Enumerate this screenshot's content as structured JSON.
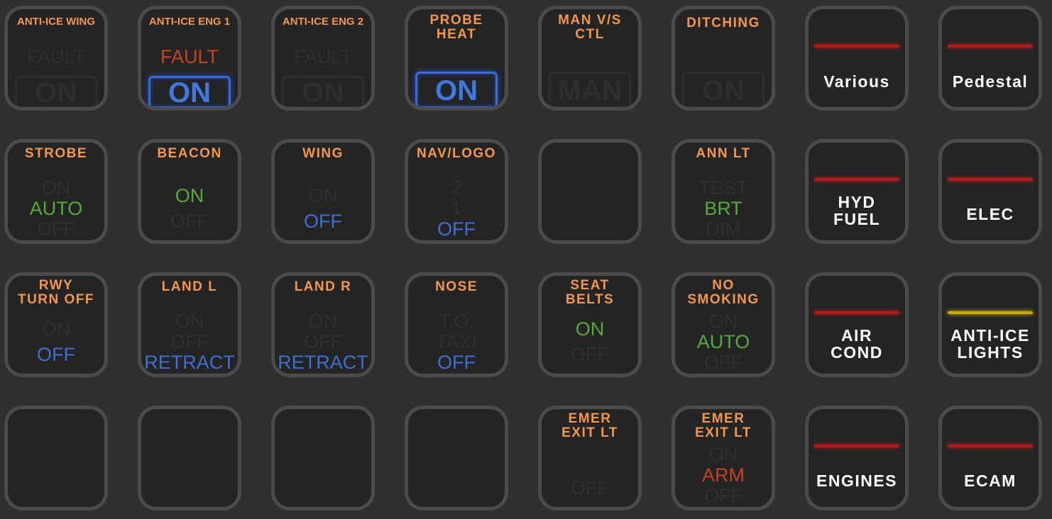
{
  "keys": {
    "anti_ice_wing": {
      "title": "ANTI-ICE WING",
      "fault": "FAULT",
      "on": "ON"
    },
    "anti_ice_eng1": {
      "title": "ANTI-ICE ENG 1",
      "fault": "FAULT",
      "on": "ON"
    },
    "anti_ice_eng2": {
      "title": "ANTI-ICE ENG 2",
      "fault": "FAULT",
      "on": "ON"
    },
    "probe_heat": {
      "title": "PROBE\nHEAT",
      "on": "ON"
    },
    "man_vs_ctl": {
      "title": "MAN V/S\nCTL",
      "value": "MAN"
    },
    "ditching": {
      "title": "DITCHING",
      "on": "ON"
    },
    "various": {
      "label": "Various"
    },
    "pedestal": {
      "label": "Pedestal"
    },
    "strobe": {
      "title": "STROBE",
      "opt1": "ON",
      "opt2": "AUTO",
      "opt3": "OFF"
    },
    "beacon": {
      "title": "BEACON",
      "opt1": "ON",
      "opt2": "OFF"
    },
    "wing": {
      "title": "WING",
      "opt1": "ON",
      "opt2": "OFF"
    },
    "nav_logo": {
      "title": "NAV/LOGO",
      "opt1": "2",
      "opt2": "1",
      "opt3": "OFF"
    },
    "ann_lt": {
      "title": "ANN LT",
      "opt1": "TEST",
      "opt2": "BRT",
      "opt3": "DIM"
    },
    "hyd_fuel": {
      "label": "HYD\nFUEL"
    },
    "elec": {
      "label": "ELEC"
    },
    "rwy_turn_off": {
      "title": "RWY\nTURN OFF",
      "opt1": "ON",
      "opt2": "OFF"
    },
    "land_l": {
      "title": "LAND L",
      "opt1": "ON",
      "opt2": "OFF",
      "opt3": "RETRACT"
    },
    "land_r": {
      "title": "LAND R",
      "opt1": "ON",
      "opt2": "OFF",
      "opt3": "RETRACT"
    },
    "nose": {
      "title": "NOSE",
      "opt1": "T.O.",
      "opt2": "TAXI",
      "opt3": "OFF"
    },
    "seat_belts": {
      "title": "SEAT\nBELTS",
      "opt1": "ON",
      "opt2": "OFF"
    },
    "no_smoking": {
      "title": "NO\nSMOKING",
      "opt1": "ON",
      "opt2": "AUTO",
      "opt3": "OFF"
    },
    "air_cond": {
      "label": "AIR\nCOND"
    },
    "anti_ice_lights": {
      "label": "ANTI-ICE\nLIGHTS"
    },
    "emer_exit_lt_1": {
      "title": "EMER\nEXIT LT",
      "opt1": "OFF"
    },
    "emer_exit_lt_2": {
      "title": "EMER\nEXIT LT",
      "opt1": "ON",
      "opt2": "ARM",
      "opt3": "OFF"
    },
    "engines": {
      "label": "ENGINES"
    },
    "ecam": {
      "label": "ECAM"
    }
  },
  "colors": {
    "background": "#2f2f2f",
    "key_face": "#242424",
    "key_border": "#4b4b4b",
    "title_orange": "#f3964e",
    "state_green": "#56a93a",
    "state_blue": "#3f6fd1",
    "state_red": "#c5431f",
    "state_dim": "#303030",
    "bar_red": "#b21a1a",
    "bar_amber": "#c8a812"
  }
}
